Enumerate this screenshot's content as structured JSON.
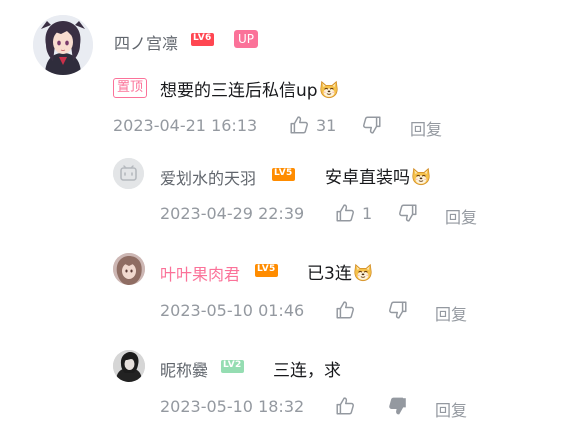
{
  "comment": {
    "username": "四ノ宫凛",
    "level": "LV6",
    "up_badge": "UP",
    "pin_label": "置顶",
    "content": "想要的三连后私信up",
    "emoji": "doge-emoji",
    "time": "2023-04-21 16:13",
    "likes": "31",
    "reply_label": "回复"
  },
  "replies": [
    {
      "username": "爱划水的天羽",
      "level": "LV5",
      "content": "安卓直装吗",
      "emoji": "doge-emoji",
      "time": "2023-04-29 22:39",
      "likes": "1",
      "reply_label": "回复"
    },
    {
      "username": "叶叶果肉君",
      "level": "LV5",
      "content": "已3连",
      "emoji": "doge-emoji",
      "time": "2023-05-10 01:46",
      "likes": "",
      "reply_label": "回复"
    },
    {
      "username": "昵称爨",
      "level": "LV2",
      "content": "三连，求",
      "time": "2023-05-10 18:32",
      "likes": "",
      "reply_label": "回复"
    }
  ],
  "colors": {
    "pink": "#fb7299",
    "gray_text": "#9499a0",
    "name_text": "#61666d",
    "lv6": "#ff4651",
    "lv5": "#ff8c00",
    "lv2": "#95ddb2"
  }
}
